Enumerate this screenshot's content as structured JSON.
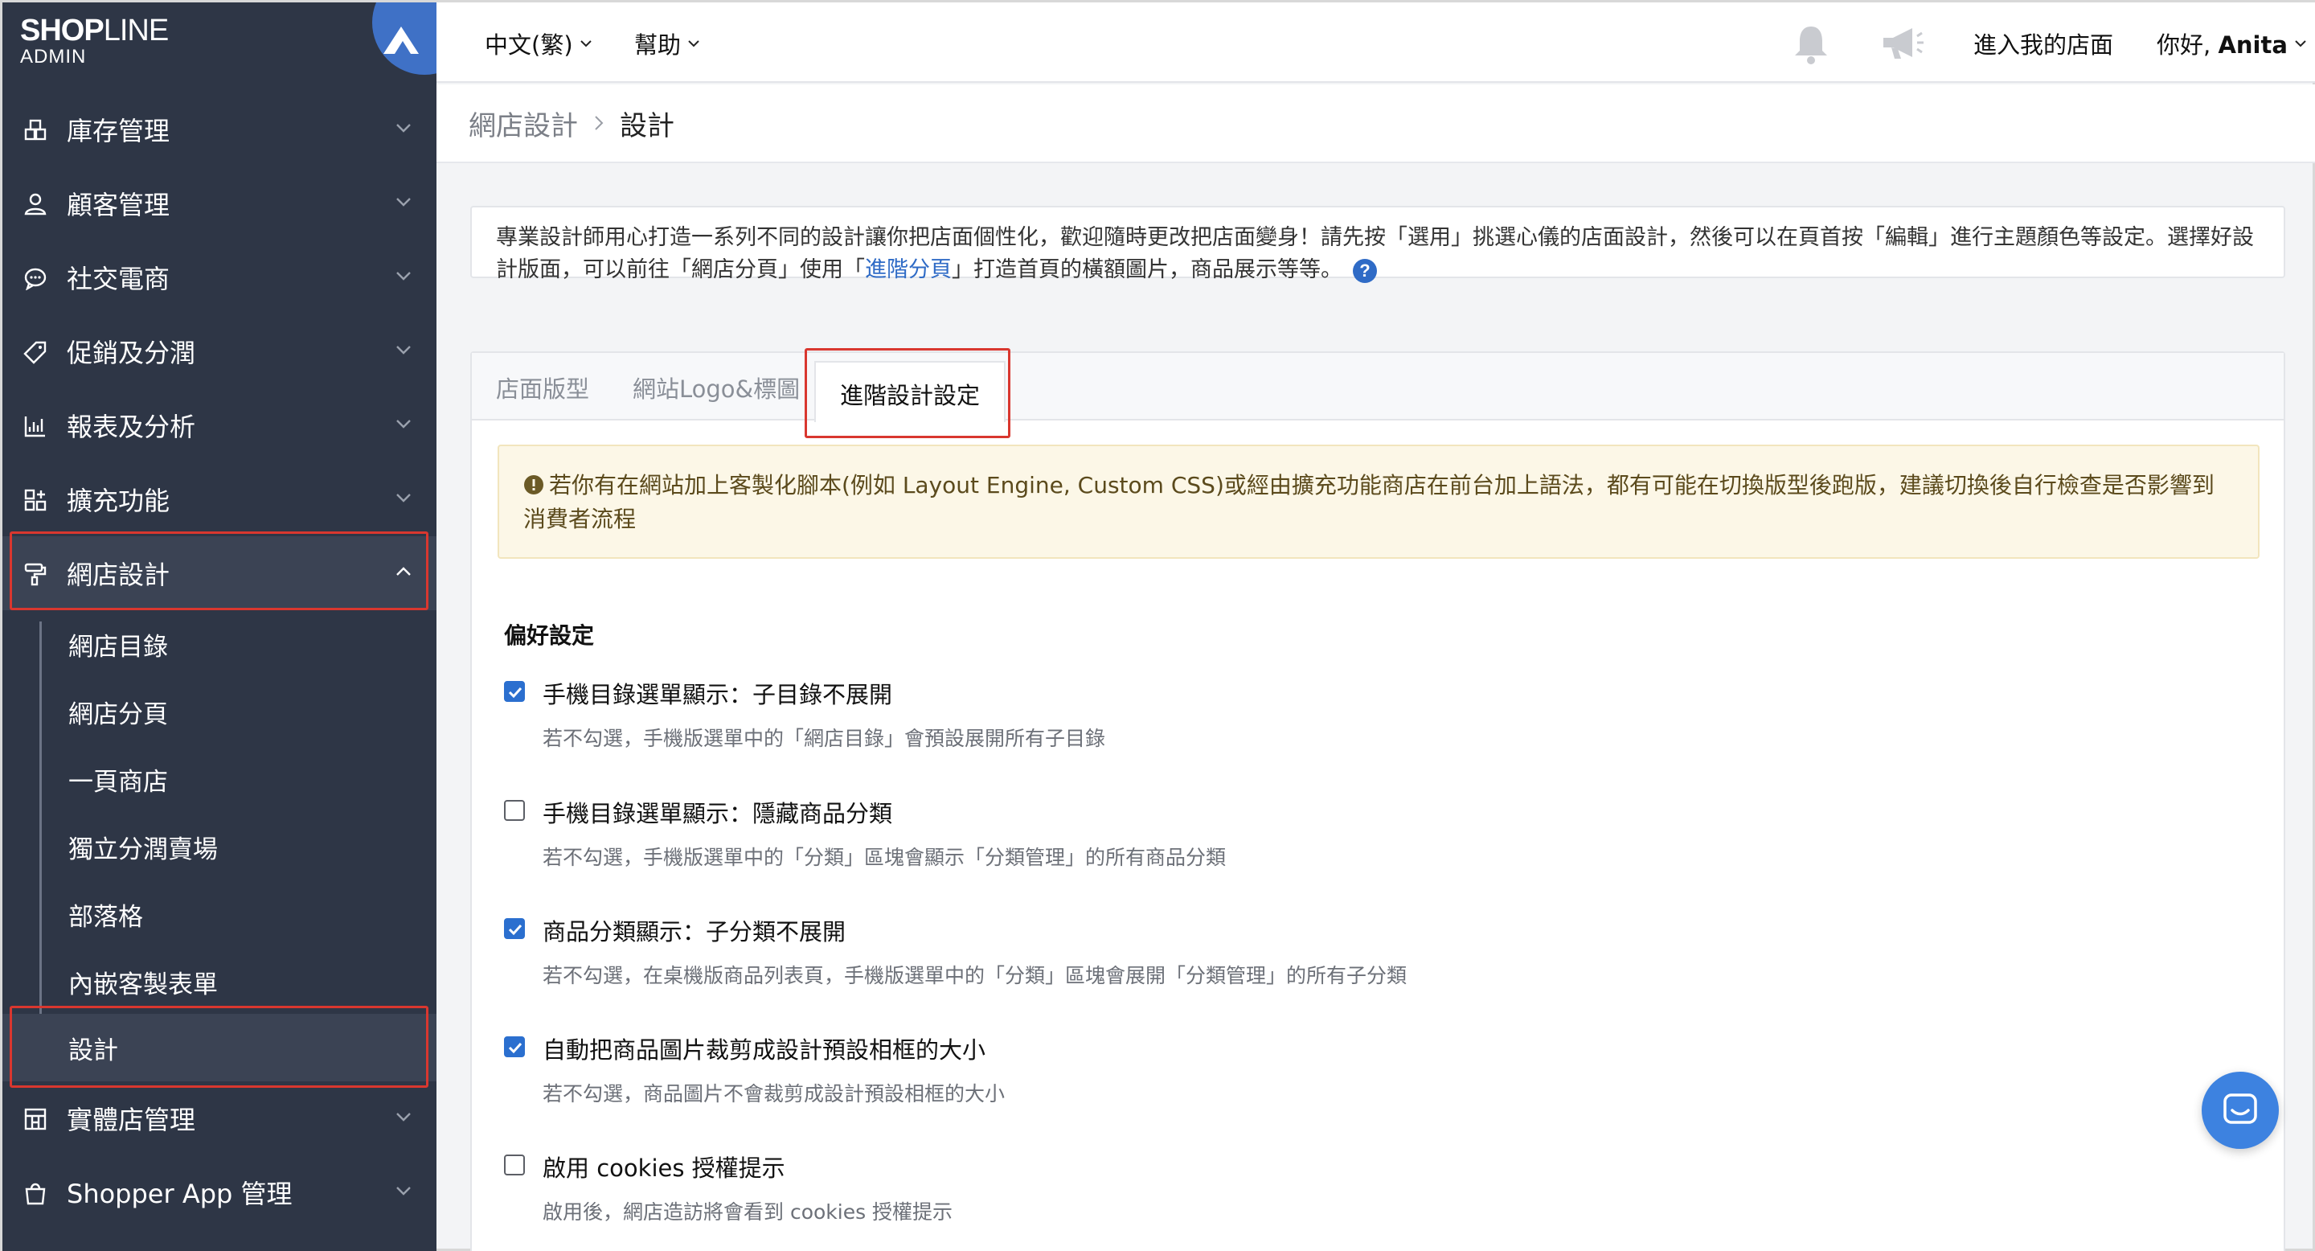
{
  "logo": {
    "brand_bold": "SHOP",
    "brand_light": "LINE",
    "sub": "ADMIN"
  },
  "sidebar": {
    "items": [
      {
        "label": "庫存管理",
        "icon": "inventory-icon"
      },
      {
        "label": "顧客管理",
        "icon": "customer-icon"
      },
      {
        "label": "社交電商",
        "icon": "chat-bubble-icon"
      },
      {
        "label": "促銷及分潤",
        "icon": "tag-icon"
      },
      {
        "label": "報表及分析",
        "icon": "chart-icon"
      },
      {
        "label": "擴充功能",
        "icon": "apps-grid-icon"
      },
      {
        "label": "網店設計",
        "icon": "paint-roller-icon",
        "expanded": true
      },
      {
        "label": "實體店管理",
        "icon": "store-icon"
      },
      {
        "label": "Shopper App 管理",
        "icon": "shopping-bag-icon"
      }
    ],
    "sub_items": [
      {
        "label": "網店目錄"
      },
      {
        "label": "網店分頁"
      },
      {
        "label": "一頁商店"
      },
      {
        "label": "獨立分潤賣場"
      },
      {
        "label": "部落格"
      },
      {
        "label": "內嵌客製表單"
      },
      {
        "label": "設計",
        "active": true
      }
    ]
  },
  "topbar": {
    "language": "中文(繁)",
    "help": "幫助",
    "visit_store": "進入我的店面",
    "greeting": "你好, ",
    "user_name": "Anita"
  },
  "breadcrumb": {
    "parent": "網店設計",
    "current": "設計"
  },
  "intro": {
    "text_before_link": "專業設計師用心打造一系列不同的設計讓你把店面個性化，歡迎隨時更改把店面變身！請先按「選用」挑選心儀的店面設計，然後可以在頁首按「編輯」進行主題顏色等設定。選擇好設計版面，可以前往「網店分頁」使用「",
    "link": "進階分頁",
    "text_after_link": "」打造首頁的橫額圖片，商品展示等等。"
  },
  "tabs": [
    {
      "label": "店面版型"
    },
    {
      "label": "網站Logo&標圖"
    },
    {
      "label": "進階設計設定",
      "active": true
    }
  ],
  "warning": "若你有在網站加上客製化腳本(例如 Layout Engine, Custom CSS)或經由擴充功能商店在前台加上語法，都有可能在切換版型後跑版，建議切換後自行檢查是否影響到消費者流程",
  "preferences": {
    "title": "偏好設定",
    "options": [
      {
        "label": "手機目錄選單顯示：子目錄不展開",
        "desc": "若不勾選，手機版選單中的「網店目錄」會預設展開所有子目錄",
        "checked": true
      },
      {
        "label": "手機目錄選單顯示：隱藏商品分類",
        "desc": "若不勾選，手機版選單中的「分類」區塊會顯示「分類管理」的所有商品分類",
        "checked": false
      },
      {
        "label": "商品分類顯示：子分類不展開",
        "desc": "若不勾選，在桌機版商品列表頁，手機版選單中的「分類」區塊會展開「分類管理」的所有子分類",
        "checked": true
      },
      {
        "label": "自動把商品圖片裁剪成設計預設相框的大小",
        "desc": "若不勾選，商品圖片不會裁剪成設計預設相框的大小",
        "checked": true
      },
      {
        "label": "啟用 cookies 授權提示",
        "desc": "啟用後，網店造訪將會看到 cookies 授權提示",
        "checked": false
      }
    ]
  },
  "colors": {
    "sidebar_bg": "#2e3646",
    "accent": "#2b6fcf",
    "highlight": "#d9372f",
    "warning_bg": "#fcf7e7"
  }
}
